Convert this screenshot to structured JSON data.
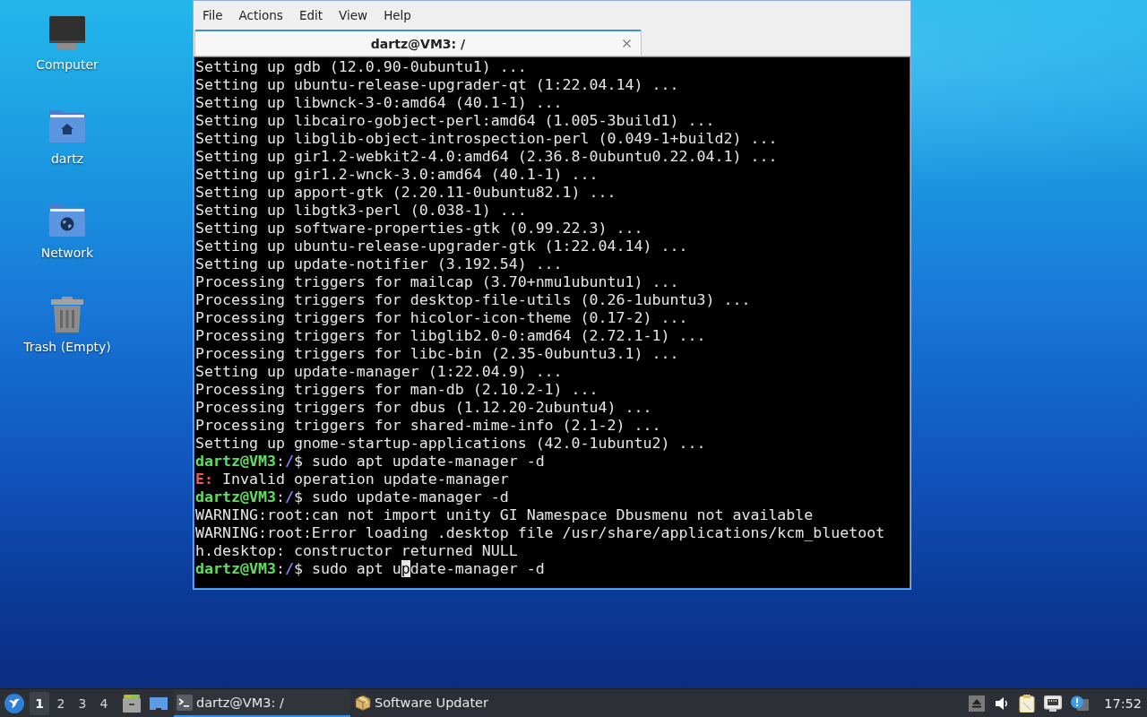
{
  "desktop_icons": [
    {
      "kind": "computer",
      "label": "Computer"
    },
    {
      "kind": "home",
      "label": "dartz"
    },
    {
      "kind": "network",
      "label": "Network"
    },
    {
      "kind": "trash",
      "label": "Trash (Empty)"
    }
  ],
  "terminal_window": {
    "menu": [
      "File",
      "Actions",
      "Edit",
      "View",
      "Help"
    ],
    "tabs": [
      {
        "label": "dartz@VM3: /",
        "selected": true
      }
    ],
    "lines": [
      [
        {
          "kind": "output",
          "text": "Setting up gdb (12.0.90-0ubuntu1) ..."
        }
      ],
      [
        {
          "kind": "output",
          "text": "Setting up ubuntu-release-upgrader-qt (1:22.04.14) ..."
        }
      ],
      [
        {
          "kind": "output",
          "text": "Setting up libwnck-3-0:amd64 (40.1-1) ..."
        }
      ],
      [
        {
          "kind": "output",
          "text": "Setting up libcairo-gobject-perl:amd64 (1.005-3build1) ..."
        }
      ],
      [
        {
          "kind": "output",
          "text": "Setting up libglib-object-introspection-perl (0.049-1+build2) ..."
        }
      ],
      [
        {
          "kind": "output",
          "text": "Setting up gir1.2-webkit2-4.0:amd64 (2.36.8-0ubuntu0.22.04.1) ..."
        }
      ],
      [
        {
          "kind": "output",
          "text": "Setting up gir1.2-wnck-3.0:amd64 (40.1-1) ..."
        }
      ],
      [
        {
          "kind": "output",
          "text": "Setting up apport-gtk (2.20.11-0ubuntu82.1) ..."
        }
      ],
      [
        {
          "kind": "output",
          "text": "Setting up libgtk3-perl (0.038-1) ..."
        }
      ],
      [
        {
          "kind": "output",
          "text": "Setting up software-properties-gtk (0.99.22.3) ..."
        }
      ],
      [
        {
          "kind": "output",
          "text": "Setting up ubuntu-release-upgrader-gtk (1:22.04.14) ..."
        }
      ],
      [
        {
          "kind": "output",
          "text": "Setting up update-notifier (3.192.54) ..."
        }
      ],
      [
        {
          "kind": "output",
          "text": "Processing triggers for mailcap (3.70+nmu1ubuntu1) ..."
        }
      ],
      [
        {
          "kind": "output",
          "text": "Processing triggers for desktop-file-utils (0.26-1ubuntu3) ..."
        }
      ],
      [
        {
          "kind": "output",
          "text": "Processing triggers for hicolor-icon-theme (0.17-2) ..."
        }
      ],
      [
        {
          "kind": "output",
          "text": "Processing triggers for libglib2.0-0:amd64 (2.72.1-1) ..."
        }
      ],
      [
        {
          "kind": "output",
          "text": "Processing triggers for libc-bin (2.35-0ubuntu3.1) ..."
        }
      ],
      [
        {
          "kind": "output",
          "text": "Setting up update-manager (1:22.04.9) ..."
        }
      ],
      [
        {
          "kind": "output",
          "text": "Processing triggers for man-db (2.10.2-1) ..."
        }
      ],
      [
        {
          "kind": "output",
          "text": "Processing triggers for dbus (1.12.20-2ubuntu4) ..."
        }
      ],
      [
        {
          "kind": "output",
          "text": "Processing triggers for shared-mime-info (2.1-2) ..."
        }
      ],
      [
        {
          "kind": "output",
          "text": "Setting up gnome-startup-applications (42.0-1ubuntu2) ..."
        }
      ],
      [
        {
          "kind": "user",
          "text": "dartz@VM3"
        },
        {
          "kind": "output",
          "text": ":"
        },
        {
          "kind": "path",
          "text": "/"
        },
        {
          "kind": "output",
          "text": "$ sudo apt update-manager -d"
        }
      ],
      [
        {
          "kind": "error",
          "text": "E:"
        },
        {
          "kind": "output",
          "text": " Invalid operation update-manager"
        }
      ],
      [
        {
          "kind": "user",
          "text": "dartz@VM3"
        },
        {
          "kind": "output",
          "text": ":"
        },
        {
          "kind": "path",
          "text": "/"
        },
        {
          "kind": "output",
          "text": "$ sudo update-manager -d"
        }
      ],
      [
        {
          "kind": "output",
          "text": "WARNING:root:can not import unity GI Namespace Dbusmenu not available"
        }
      ],
      [
        {
          "kind": "output",
          "text": "WARNING:root:Error loading .desktop file /usr/share/applications/kcm_bluetoot"
        }
      ],
      [
        {
          "kind": "output",
          "text": "h.desktop: constructor returned NULL"
        }
      ],
      [
        {
          "kind": "user",
          "text": "dartz@VM3"
        },
        {
          "kind": "output",
          "text": ":"
        },
        {
          "kind": "path",
          "text": "/"
        },
        {
          "kind": "output",
          "text": "$ sudo apt u"
        },
        {
          "kind": "cursor",
          "text": "p"
        },
        {
          "kind": "output",
          "text": "date-manager -d"
        }
      ]
    ]
  },
  "taskbar": {
    "workspaces": [
      {
        "label": "1",
        "selected": true
      },
      {
        "label": "2",
        "selected": false
      },
      {
        "label": "3",
        "selected": false
      },
      {
        "label": "4",
        "selected": false
      }
    ],
    "tasks": [
      {
        "kind": "terminal",
        "label": "dartz@VM3: /",
        "selected": true
      },
      {
        "kind": "updater",
        "label": "Software Updater",
        "selected": false
      }
    ],
    "clock": "17:52"
  }
}
